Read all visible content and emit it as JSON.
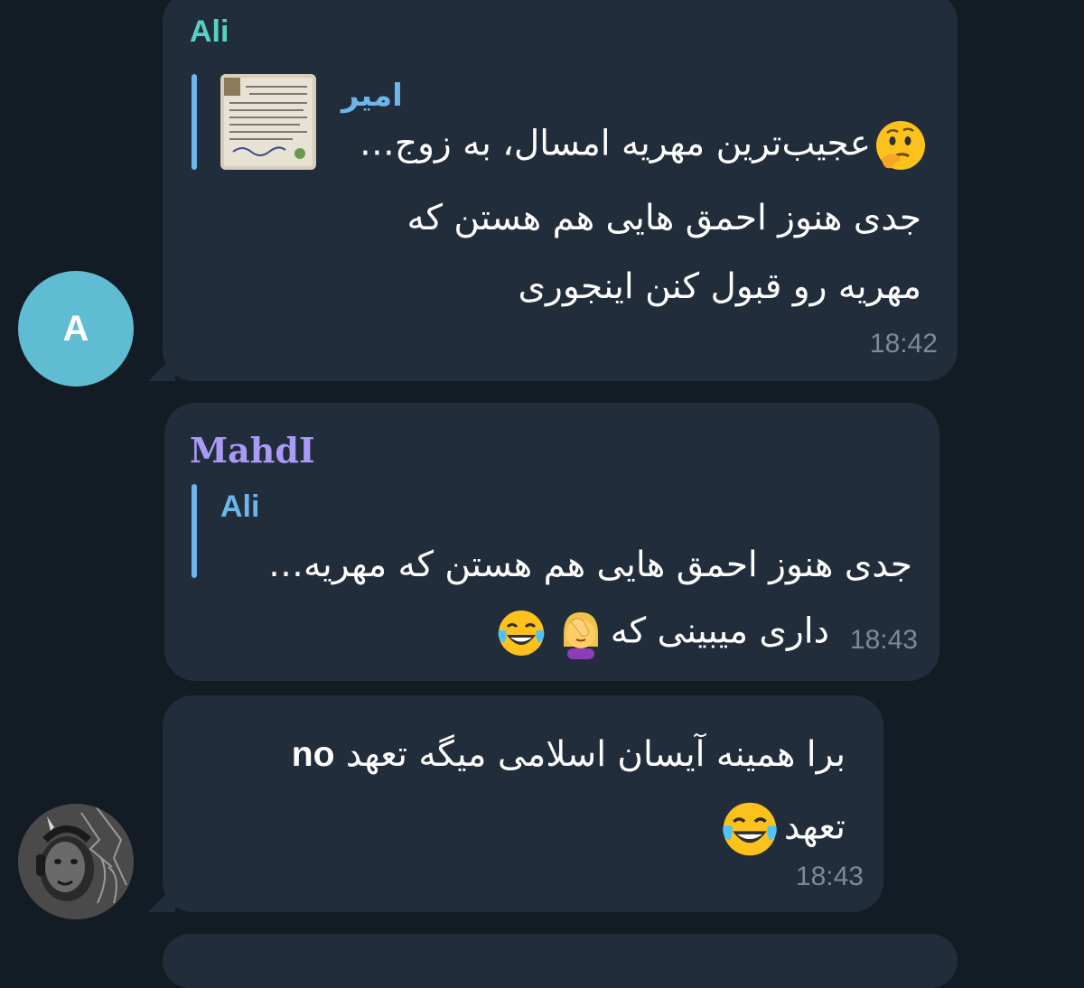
{
  "messages": [
    {
      "sender": "Ali",
      "reply": {
        "author": "امیر",
        "text": "عجیب‌ترین مهریه امسال، به زوج…"
      },
      "lines": [
        "جدی هنوز احمق هایی هم هستن که",
        "مهریه رو قبول کنن اینجوری"
      ],
      "time": "18:42"
    },
    {
      "sender": "MahdI",
      "reply": {
        "author": "Ali",
        "text": "جدی هنوز احمق هایی هم هستن که مهریه…"
      },
      "text": "داری میبینی که",
      "time": "18:43"
    },
    {
      "sender": "",
      "line1": "برا همینه آیسان اسلامی میگه تعهد",
      "line1_en": "no",
      "line2": "تعهد",
      "time": "18:43"
    }
  ],
  "avatars": {
    "ali_letter": "A",
    "ali_color": "#5fbcd3"
  },
  "colors": {
    "background": "#131b24",
    "bubble": "#212d3b",
    "ali_name": "#58d0c3",
    "mahdi_name": "#a99af6",
    "reply_author": "#6cb6ea",
    "reply_bar": "#6cb6ea",
    "time": "#7b8a99"
  },
  "icons": [
    "thinking-emoji",
    "facepalm-emoji",
    "tears-of-joy-emoji",
    "document-thumbnail"
  ]
}
